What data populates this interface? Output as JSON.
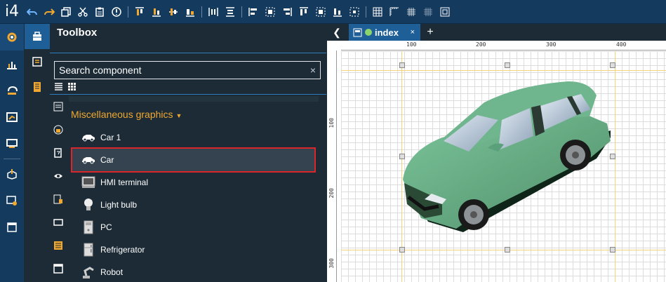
{
  "app": {
    "logo": "i4"
  },
  "toolbar": {
    "icons": [
      "undo-icon",
      "redo-icon",
      "copy-icon",
      "cut-icon",
      "paste-icon",
      "info-icon",
      "align-top-icon",
      "align-bottom-icon",
      "align-middle-icon",
      "align-center-icon",
      "distribute-h-icon",
      "distribute-v-icon",
      "align-left-edge-icon",
      "align-center-h-icon",
      "align-right-edge-icon",
      "align-top-edge-icon",
      "align-middle-v-icon",
      "align-bottom-edge-icon",
      "align-page-icon",
      "grid-icon",
      "ruler-icon",
      "snap-grid-icon",
      "snap-objects-icon",
      "fit-screen-icon"
    ]
  },
  "leftbar": {
    "items": [
      "settings-icon",
      "chart-icon",
      "stamp-icon",
      "dashboard-icon",
      "screen-icon",
      "deploy-icon",
      "monitor-icon",
      "window-icon"
    ]
  },
  "toolbox": {
    "title": "Toolbox",
    "search_placeholder": "Search component",
    "search_clear": "×",
    "category": "Miscellaneous graphics",
    "items": [
      {
        "label": "Car 1",
        "icon": "car-icon"
      },
      {
        "label": "Car",
        "icon": "car-icon"
      },
      {
        "label": "HMI terminal",
        "icon": "terminal-icon"
      },
      {
        "label": "Light bulb",
        "icon": "bulb-icon"
      },
      {
        "label": "PC",
        "icon": "pc-icon"
      },
      {
        "label": "Refrigerator",
        "icon": "fridge-icon"
      },
      {
        "label": "Robot",
        "icon": "robot-icon"
      }
    ],
    "selected_index": 1
  },
  "editor": {
    "back": "❮",
    "tab_label": "index",
    "tab_close": "×",
    "tab_add": "+",
    "ruler_top_labels": [
      "100",
      "200",
      "300",
      "400"
    ],
    "ruler_left_labels": [
      "100",
      "200",
      "300"
    ]
  },
  "colors": {
    "accent": "#1e5f98",
    "category": "#f0a830",
    "selected_border": "#d8262b",
    "car_body": "#6ab088"
  }
}
